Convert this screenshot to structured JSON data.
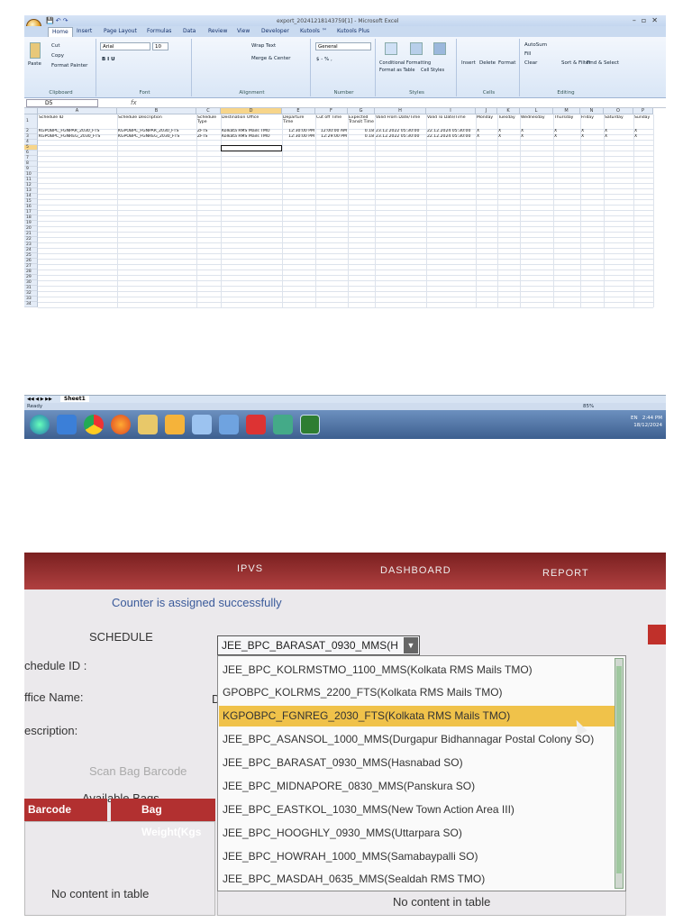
{
  "excel": {
    "title": "export_20241218143759[1] - Microsoft Excel",
    "tabs": [
      "Home",
      "Insert",
      "Page Layout",
      "Formulas",
      "Data",
      "Review",
      "View",
      "Developer",
      "Kutools ™",
      "Kutools Plus"
    ],
    "ribbon": {
      "clipboard": {
        "paste": "Paste",
        "cut": "Cut",
        "copy": "Copy",
        "format_painter": "Format Painter",
        "label": "Clipboard"
      },
      "font": {
        "name": "Arial",
        "size": "10",
        "label": "Font"
      },
      "alignment": {
        "wrap": "Wrap Text",
        "merge": "Merge & Center",
        "label": "Alignment"
      },
      "number": {
        "format": "General",
        "symbols": "$ - % ,",
        "label": "Number"
      },
      "styles": {
        "conditional": "Conditional Formatting",
        "format_table": "Format as Table",
        "cell_styles": "Cell Styles",
        "label": "Styles"
      },
      "cells": {
        "insert": "Insert",
        "delete": "Delete",
        "format": "Format",
        "label": "Cells"
      },
      "editing": {
        "autosum": "AutoSum",
        "fill": "Fill",
        "clear": "Clear",
        "sort": "Sort & Filter",
        "find": "Find & Select",
        "label": "Editing"
      }
    },
    "name_box": "D5",
    "fx": "fx",
    "columns": [
      "A",
      "B",
      "C",
      "D",
      "E",
      "F",
      "G",
      "H",
      "I",
      "J",
      "K",
      "L",
      "M",
      "N",
      "O",
      "P"
    ],
    "headers": [
      "Schedule ID",
      "Schedule Description",
      "Schedule Type",
      "Destination Office",
      "Departure Time",
      "Cut off Time",
      "Expected Transit Time",
      "Valid From Date/Time",
      "Valid To Date/Time",
      "Monday",
      "Tuesday",
      "Wednesday",
      "Thursday",
      "Friday",
      "Saturday",
      "Sunday"
    ],
    "rows": [
      [
        "KGPOBPC_FGNPAR_2030_FTS",
        "KGPOBPC_FGNPAR_2030_FTS",
        "ZFTS",
        "Kolkata RMS Mails TMO",
        "12:30:00 PM",
        "12:00:00 AM",
        "0.18",
        "23.12.2022 05:30:00",
        "22.12.2024 05:30:00",
        "X",
        "X",
        "X",
        "X",
        "X",
        "X",
        "X"
      ],
      [
        "KGPOBPC_FGNREG_2030_FTS",
        "KGPOBPC_FGNREG_2030_FTS",
        "ZFTS",
        "Kolkata RMS Mails TMO",
        "12:30:00 PM",
        "12:29:00 PM",
        "0.18",
        "23.12.2022 05:30:00",
        "22.12.2024 05:30:00",
        "X",
        "X",
        "X",
        "X",
        "X",
        "X",
        "X"
      ]
    ],
    "row_numbers": [
      "1",
      "2",
      "3",
      "4",
      "5",
      "6",
      "7",
      "8",
      "9",
      "10",
      "11",
      "12",
      "13",
      "14",
      "15",
      "16",
      "17",
      "18",
      "19",
      "20",
      "21",
      "22",
      "23",
      "24",
      "25",
      "26",
      "27",
      "28",
      "29",
      "30",
      "31",
      "32",
      "33",
      "34"
    ],
    "sheet_tab": "Sheet1",
    "status": "Ready",
    "zoom": "85%",
    "tray": {
      "lang": "EN",
      "time": "2:44 PM",
      "date": "18/12/2024"
    }
  },
  "photo": {
    "nav": [
      "IPVS",
      "DASHBOARD",
      "REPORT"
    ],
    "message": "Counter is assigned successfully",
    "schedule_label": "SCHEDULE",
    "selected": "JEE_BPC_BARASAT_0930_MMS(H",
    "options": [
      "JEE_BPC_KOLRMSTMO_1100_MMS(Kolkata RMS Mails TMO)",
      "GPOBPC_KOLRMS_2200_FTS(Kolkata RMS Mails TMO)",
      "KGPOBPC_FGNREG_2030_FTS(Kolkata RMS Mails TMO)",
      "JEE_BPC_ASANSOL_1000_MMS(Durgapur Bidhannagar Postal Colony SO)",
      "JEE_BPC_BARASAT_0930_MMS(Hasnabad SO)",
      "JEE_BPC_MIDNAPORE_0830_MMS(Panskura SO)",
      "JEE_BPC_EASTKOL_1030_MMS(New Town Action Area III)",
      "JEE_BPC_HOOGHLY_0930_MMS(Uttarpara SO)",
      "JEE_BPC_HOWRAH_1000_MMS(Samabaypalli SO)",
      "JEE_BPC_MASDAH_0635_MMS(Sealdah RMS TMO)"
    ],
    "labels": {
      "schedule_id": "chedule ID :",
      "office_name": "ffice Name:",
      "description": "escription:",
      "scan": "Scan Bag Barcode",
      "available": "Available Bags",
      "barcode": "Barcode",
      "bag_weight": "Bag Weight(Kgs",
      "no_content_left": "No content in table",
      "no_content_right": "No content in table",
      "d_letter": "D"
    }
  }
}
